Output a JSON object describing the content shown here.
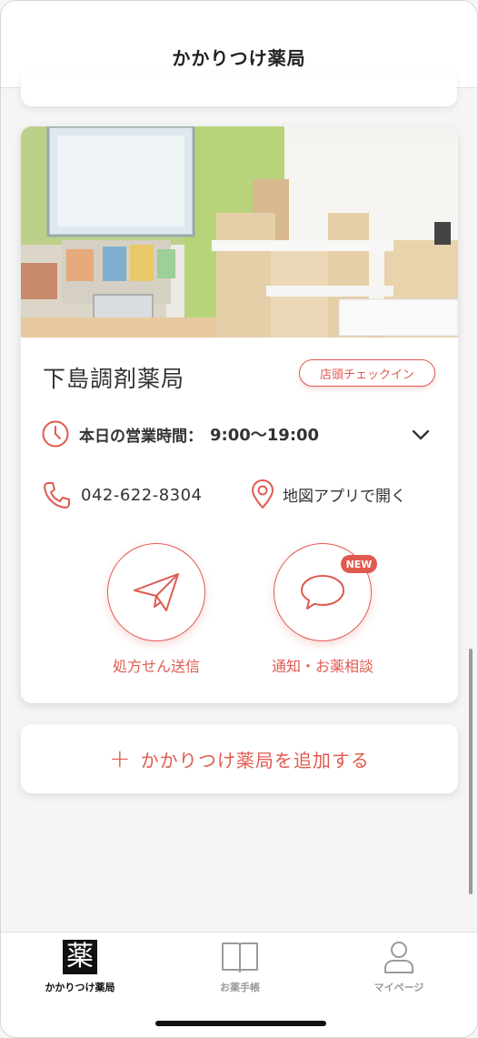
{
  "header": {
    "title": "かかりつけ薬局"
  },
  "pharmacy": {
    "name": "下島調剤薬局",
    "checkin_label": "店頭チェックイン",
    "hours_label": "本日の営業時間：",
    "hours_value": "9:00〜19:00",
    "phone": "042-622-8304",
    "map_label": "地図アプリで開く",
    "send_label": "処方せん送信",
    "consult_label": "通知・お薬相談",
    "new_badge": "NEW"
  },
  "add_pharmacy": {
    "plus": "+",
    "label": "かかりつけ薬局を追加する"
  },
  "tabbar": {
    "items": [
      {
        "icon_char": "薬",
        "label": "かかりつけ薬局",
        "active": true
      },
      {
        "label": "お薬手帳",
        "active": false
      },
      {
        "label": "マイページ",
        "active": false
      }
    ]
  },
  "colors": {
    "accent": "#e05a50",
    "inactive": "#9a9a9a",
    "active": "#111111"
  },
  "icons": [
    "clock-icon",
    "chevron-down-icon",
    "phone-icon",
    "map-pin-icon",
    "paper-plane-icon",
    "chat-bubble-icon",
    "book-icon",
    "person-icon"
  ]
}
